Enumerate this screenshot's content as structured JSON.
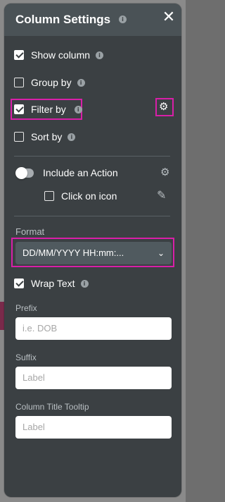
{
  "panel": {
    "title": "Column Settings",
    "info_glyph": "i",
    "close_glyph": "✕"
  },
  "options": {
    "show_column": {
      "label": "Show column",
      "checked": true
    },
    "group_by": {
      "label": "Group by",
      "checked": false
    },
    "filter_by": {
      "label": "Filter by",
      "checked": true
    },
    "sort_by": {
      "label": "Sort by",
      "checked": false
    }
  },
  "action": {
    "toggle_label": "Include an Action",
    "toggle_on": false,
    "click_on_icon_label": "Click on icon",
    "click_on_icon_checked": false
  },
  "format": {
    "label": "Format",
    "selected": "DD/MM/YYYY HH:mm:...",
    "chevron": "⌄"
  },
  "wrap_text": {
    "label": "Wrap Text",
    "checked": true
  },
  "prefix": {
    "label": "Prefix",
    "placeholder": "i.e. DOB"
  },
  "suffix": {
    "label": "Suffix",
    "placeholder": "Label"
  },
  "tooltip": {
    "label": "Column Title Tooltip",
    "placeholder": "Label"
  },
  "icons": {
    "gear": "⚙",
    "pencil": "✎"
  },
  "colors": {
    "panel_bg": "#3b4043",
    "header_bg": "#4a5256",
    "highlight": "#d81fa8"
  }
}
